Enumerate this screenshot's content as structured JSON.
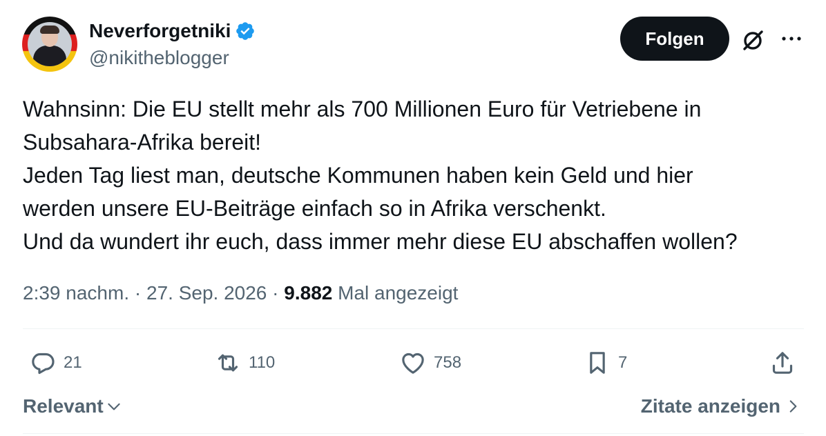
{
  "author": {
    "display_name": "Neverforgetniki",
    "handle": "@nikitheblogger",
    "verified": true
  },
  "header": {
    "follow_label": "Folgen"
  },
  "tweet": {
    "lines": [
      "Wahnsinn: Die EU stellt mehr als 700 Millionen Euro für Vetriebene in",
      "Subsahara-Afrika bereit!",
      "Jeden Tag liest man, deutsche Kommunen haben kein Geld und hier",
      "werden unsere EU-Beiträge einfach so in Afrika verschenkt.",
      "Und da wundert ihr euch, dass immer mehr diese EU abschaffen wollen?"
    ],
    "time": "2:39 nachm.",
    "date": "27. Sep. 2026",
    "views_count": "9.882",
    "views_label": "Mal angezeigt"
  },
  "actions": {
    "replies": "21",
    "reposts": "110",
    "likes": "758",
    "bookmarks": "7"
  },
  "footer": {
    "sort_label": "Relevant",
    "quotes_label": "Zitate anzeigen"
  },
  "colors": {
    "text_primary": "#0f1419",
    "text_secondary": "#536471",
    "verified_blue": "#1d9bf0",
    "divider": "#eff3f4"
  },
  "icons": {
    "verified": "verified-badge-icon",
    "grok": "grok-icon",
    "more": "more-horizontal-icon",
    "reply": "reply-icon",
    "repost": "repost-icon",
    "like": "heart-icon",
    "bookmark": "bookmark-icon",
    "share": "share-icon"
  }
}
